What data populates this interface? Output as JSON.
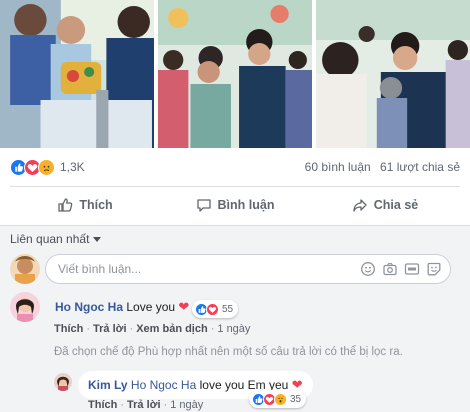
{
  "post": {
    "photos": [
      {
        "name": "photo-hospital-child"
      },
      {
        "name": "photo-greeting-elder"
      },
      {
        "name": "photo-hug"
      }
    ]
  },
  "stats": {
    "reactions": [
      "like",
      "love",
      "sad"
    ],
    "reaction_count": "1,3K",
    "comments": "60 bình luận",
    "shares": "61 lượt chia sẻ"
  },
  "actions": {
    "like": "Thích",
    "comment": "Bình luận",
    "share": "Chia sẻ"
  },
  "sort": {
    "label": "Liên quan nhất"
  },
  "composer": {
    "placeholder": "Viết bình luận...",
    "icons": [
      "emoji-icon",
      "camera-icon",
      "gif-icon",
      "sticker-icon"
    ]
  },
  "comments": [
    {
      "author": "Ho Ngoc Ha",
      "text": "Love you",
      "reaction_count": "55",
      "reactions": [
        "like",
        "love"
      ],
      "like": "Thích",
      "reply": "Trả lời",
      "translate": "Xem bản dịch",
      "time": "1 ngày"
    }
  ],
  "filtered_notice": "Đã chọn chế độ Phù hợp nhất nên một số câu trả lời có thể bị lọc ra.",
  "replies": [
    {
      "author": "Kim Ly",
      "mention": "Ho Ngoc Ha",
      "text": "love you Em yeu",
      "reaction_count": "35",
      "reactions": [
        "like",
        "love",
        "wow"
      ],
      "like": "Thích",
      "reply": "Trả lời",
      "time": "1 ngày"
    }
  ],
  "colors": {
    "like": "#1877f2",
    "love": "#f33e58",
    "sad": "#f7b125",
    "link": "#385898",
    "muted": "#606770"
  }
}
